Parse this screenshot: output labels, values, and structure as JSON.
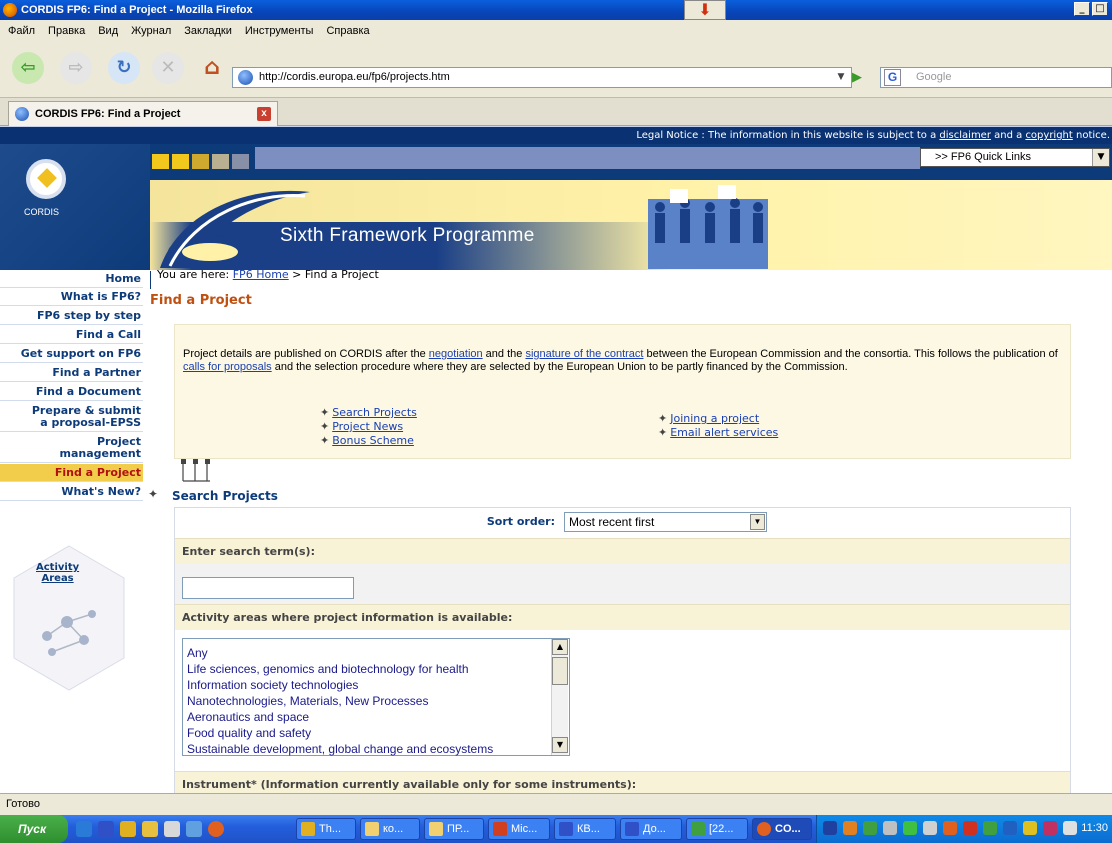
{
  "window": {
    "title": "CORDIS FP6: Find a Project - Mozilla Firefox"
  },
  "menu": [
    "Файл",
    "Правка",
    "Вид",
    "Журнал",
    "Закладки",
    "Инструменты",
    "Справка"
  ],
  "toolbar": {
    "url": "http://cordis.europa.eu/fp6/projects.htm",
    "search_placeholder": "Google"
  },
  "tab": {
    "label": "CORDIS FP6: Find a Project"
  },
  "site": {
    "legal_prefix": "Legal Notice : The information in this website is subject to a ",
    "disclaimer": "disclaimer",
    "legal_and": " and a ",
    "copyright": "copyright",
    "legal_suffix": " notice.",
    "quick_links": ">> FP6 Quick Links",
    "logo_text": "CORDIS",
    "programme": "Sixth Framework Programme"
  },
  "breadcrumb": {
    "prefix": "You are here: ",
    "home": "FP6 Home",
    "current": " > Find a Project"
  },
  "nav": [
    "Home",
    "What is FP6?",
    "FP6 step by step",
    "Find a Call",
    "Get support on FP6",
    "Find a Partner",
    "Find a Document",
    "Prepare & submit\na proposal-EPSS",
    "Project\nmanagement",
    "Find a Project",
    "What's New?"
  ],
  "activity": {
    "line1": "Activity",
    "line2": "Areas"
  },
  "page": {
    "title": "Find a Project",
    "intro": {
      "t1": "Project details are published on CORDIS after the ",
      "l1": "negotiation",
      "t2": " and the ",
      "l2": "signature of the contract",
      "t3": " between the European Commission and the consortia. This follows the publication of ",
      "l3": "calls for proposals",
      "t4": " and the selection procedure where they are selected by the European Union to be partly financed by the Commission."
    },
    "links_left": [
      "Search Projects",
      "Project News",
      "Bonus Scheme"
    ],
    "links_right": [
      "Joining a project",
      "Email alert services"
    ],
    "search_heading": "Search Projects"
  },
  "form": {
    "sort_label": "Sort order:",
    "sort_value": "Most recent first",
    "search_label": "Enter search term(s):",
    "search_value": "",
    "activity_label": "Activity areas where project information is available:",
    "activity_options": [
      "Any",
      "Life sciences, genomics and biotechnology for health",
      "Information society technologies",
      "Nanotechnologies, Materials, New Processes",
      "Aeronautics and space",
      "Food quality and safety",
      "Sustainable development, global change and ecosystems"
    ],
    "instrument_label": "Instrument* (Information currently available only for some instruments):"
  },
  "status": "Готово",
  "taskbar": {
    "start": "Пуск",
    "items": [
      "Th...",
      "ко...",
      "ПР...",
      "Mic...",
      "КВ...",
      "До...",
      "[22...",
      "CO..."
    ],
    "clock": "11:30"
  }
}
